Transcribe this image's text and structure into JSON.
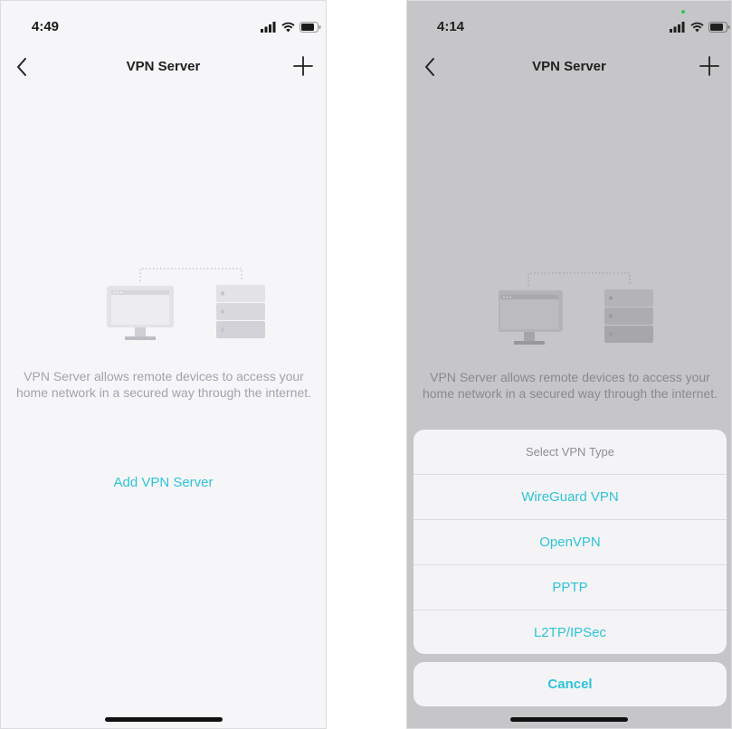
{
  "left_screen": {
    "status_bar": {
      "time": "4:49"
    },
    "nav": {
      "title": "VPN Server"
    },
    "description": "VPN Server allows remote devices to access your home network in a secured way through the internet.",
    "add_link": "Add VPN Server"
  },
  "right_screen": {
    "status_bar": {
      "time": "4:14"
    },
    "nav": {
      "title": "VPN Server"
    },
    "description": "VPN Server allows remote devices to access your home network in a secured way through the internet.",
    "action_sheet": {
      "title": "Select VPN Type",
      "options": [
        "WireGuard VPN",
        "OpenVPN",
        "PPTP",
        "L2TP/IPSec"
      ],
      "cancel": "Cancel"
    }
  },
  "colors": {
    "accent": "#2ec3d6",
    "background_light": "#f6f6f8",
    "background_dimmed": "#c6c6c8",
    "text_muted": "#a4a4a8"
  },
  "icons": [
    "back-chevron-icon",
    "plus-icon",
    "signal-icon",
    "wifi-icon",
    "battery-icon",
    "computer-icon",
    "server-icon"
  ]
}
